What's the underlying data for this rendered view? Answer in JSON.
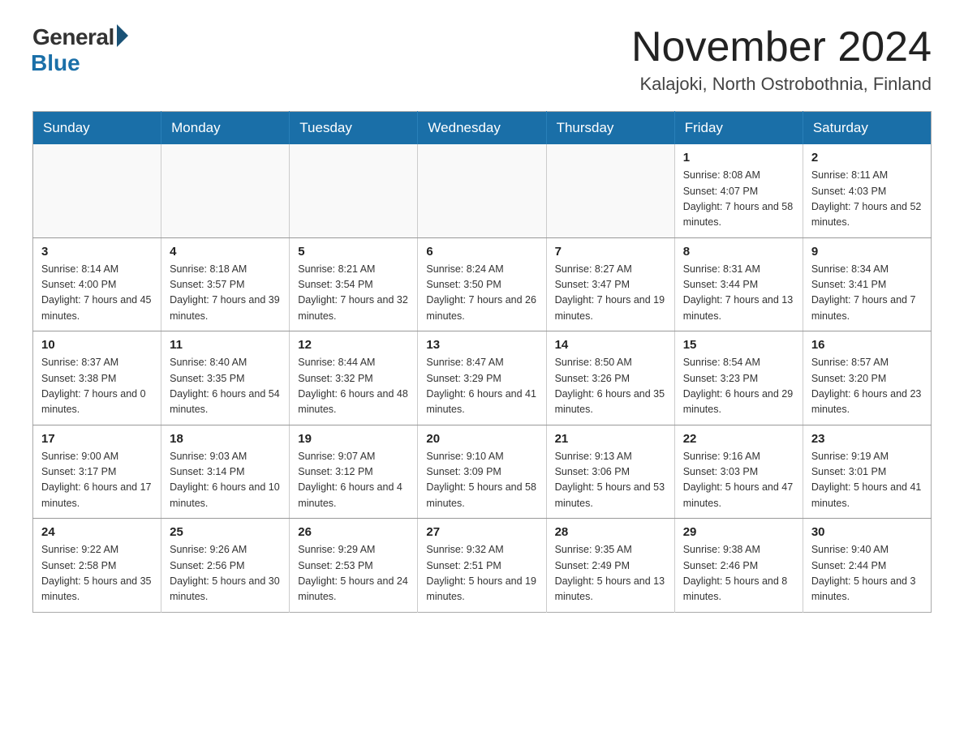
{
  "header": {
    "logo_general": "General",
    "logo_blue": "Blue",
    "month_title": "November 2024",
    "location": "Kalajoki, North Ostrobothnia, Finland"
  },
  "days_of_week": [
    "Sunday",
    "Monday",
    "Tuesday",
    "Wednesday",
    "Thursday",
    "Friday",
    "Saturday"
  ],
  "weeks": [
    [
      {
        "day": "",
        "info": ""
      },
      {
        "day": "",
        "info": ""
      },
      {
        "day": "",
        "info": ""
      },
      {
        "day": "",
        "info": ""
      },
      {
        "day": "",
        "info": ""
      },
      {
        "day": "1",
        "info": "Sunrise: 8:08 AM\nSunset: 4:07 PM\nDaylight: 7 hours\nand 58 minutes."
      },
      {
        "day": "2",
        "info": "Sunrise: 8:11 AM\nSunset: 4:03 PM\nDaylight: 7 hours\nand 52 minutes."
      }
    ],
    [
      {
        "day": "3",
        "info": "Sunrise: 8:14 AM\nSunset: 4:00 PM\nDaylight: 7 hours\nand 45 minutes."
      },
      {
        "day": "4",
        "info": "Sunrise: 8:18 AM\nSunset: 3:57 PM\nDaylight: 7 hours\nand 39 minutes."
      },
      {
        "day": "5",
        "info": "Sunrise: 8:21 AM\nSunset: 3:54 PM\nDaylight: 7 hours\nand 32 minutes."
      },
      {
        "day": "6",
        "info": "Sunrise: 8:24 AM\nSunset: 3:50 PM\nDaylight: 7 hours\nand 26 minutes."
      },
      {
        "day": "7",
        "info": "Sunrise: 8:27 AM\nSunset: 3:47 PM\nDaylight: 7 hours\nand 19 minutes."
      },
      {
        "day": "8",
        "info": "Sunrise: 8:31 AM\nSunset: 3:44 PM\nDaylight: 7 hours\nand 13 minutes."
      },
      {
        "day": "9",
        "info": "Sunrise: 8:34 AM\nSunset: 3:41 PM\nDaylight: 7 hours\nand 7 minutes."
      }
    ],
    [
      {
        "day": "10",
        "info": "Sunrise: 8:37 AM\nSunset: 3:38 PM\nDaylight: 7 hours\nand 0 minutes."
      },
      {
        "day": "11",
        "info": "Sunrise: 8:40 AM\nSunset: 3:35 PM\nDaylight: 6 hours\nand 54 minutes."
      },
      {
        "day": "12",
        "info": "Sunrise: 8:44 AM\nSunset: 3:32 PM\nDaylight: 6 hours\nand 48 minutes."
      },
      {
        "day": "13",
        "info": "Sunrise: 8:47 AM\nSunset: 3:29 PM\nDaylight: 6 hours\nand 41 minutes."
      },
      {
        "day": "14",
        "info": "Sunrise: 8:50 AM\nSunset: 3:26 PM\nDaylight: 6 hours\nand 35 minutes."
      },
      {
        "day": "15",
        "info": "Sunrise: 8:54 AM\nSunset: 3:23 PM\nDaylight: 6 hours\nand 29 minutes."
      },
      {
        "day": "16",
        "info": "Sunrise: 8:57 AM\nSunset: 3:20 PM\nDaylight: 6 hours\nand 23 minutes."
      }
    ],
    [
      {
        "day": "17",
        "info": "Sunrise: 9:00 AM\nSunset: 3:17 PM\nDaylight: 6 hours\nand 17 minutes."
      },
      {
        "day": "18",
        "info": "Sunrise: 9:03 AM\nSunset: 3:14 PM\nDaylight: 6 hours\nand 10 minutes."
      },
      {
        "day": "19",
        "info": "Sunrise: 9:07 AM\nSunset: 3:12 PM\nDaylight: 6 hours\nand 4 minutes."
      },
      {
        "day": "20",
        "info": "Sunrise: 9:10 AM\nSunset: 3:09 PM\nDaylight: 5 hours\nand 58 minutes."
      },
      {
        "day": "21",
        "info": "Sunrise: 9:13 AM\nSunset: 3:06 PM\nDaylight: 5 hours\nand 53 minutes."
      },
      {
        "day": "22",
        "info": "Sunrise: 9:16 AM\nSunset: 3:03 PM\nDaylight: 5 hours\nand 47 minutes."
      },
      {
        "day": "23",
        "info": "Sunrise: 9:19 AM\nSunset: 3:01 PM\nDaylight: 5 hours\nand 41 minutes."
      }
    ],
    [
      {
        "day": "24",
        "info": "Sunrise: 9:22 AM\nSunset: 2:58 PM\nDaylight: 5 hours\nand 35 minutes."
      },
      {
        "day": "25",
        "info": "Sunrise: 9:26 AM\nSunset: 2:56 PM\nDaylight: 5 hours\nand 30 minutes."
      },
      {
        "day": "26",
        "info": "Sunrise: 9:29 AM\nSunset: 2:53 PM\nDaylight: 5 hours\nand 24 minutes."
      },
      {
        "day": "27",
        "info": "Sunrise: 9:32 AM\nSunset: 2:51 PM\nDaylight: 5 hours\nand 19 minutes."
      },
      {
        "day": "28",
        "info": "Sunrise: 9:35 AM\nSunset: 2:49 PM\nDaylight: 5 hours\nand 13 minutes."
      },
      {
        "day": "29",
        "info": "Sunrise: 9:38 AM\nSunset: 2:46 PM\nDaylight: 5 hours\nand 8 minutes."
      },
      {
        "day": "30",
        "info": "Sunrise: 9:40 AM\nSunset: 2:44 PM\nDaylight: 5 hours\nand 3 minutes."
      }
    ]
  ]
}
